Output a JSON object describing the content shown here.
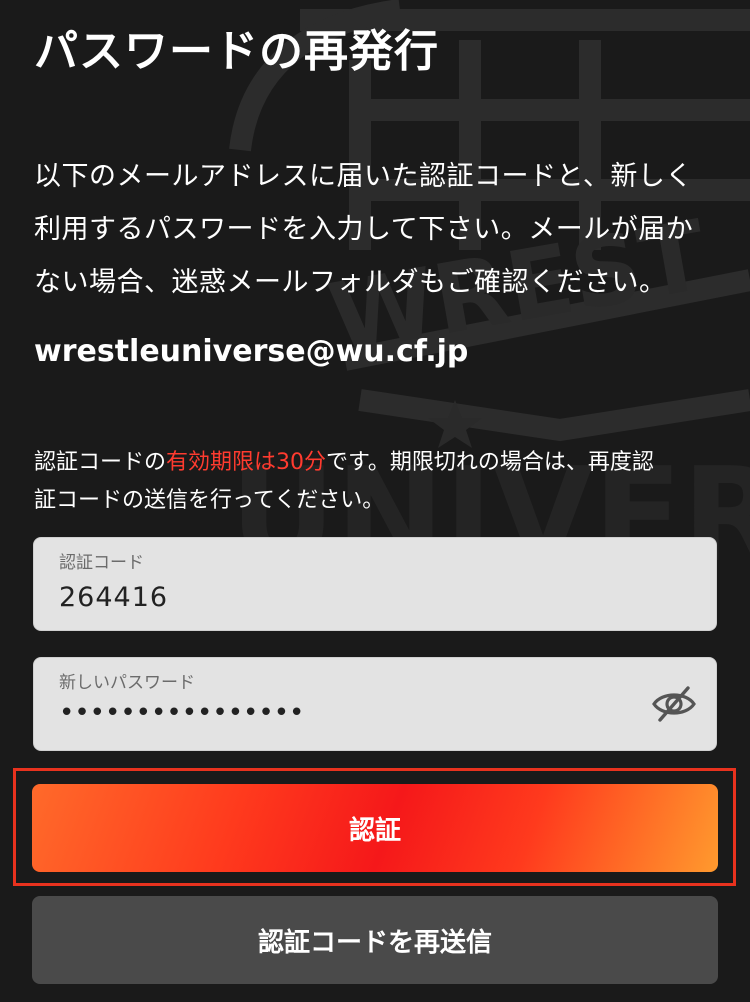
{
  "page": {
    "title": "パスワードの再発行"
  },
  "description": {
    "lines": [
      "以下のメールアドレスに届いた認証コードと、新しく",
      "利用するパスワードを入力して下さい。メールが届か",
      "ない場合、迷惑メールフォルダもご確認ください。"
    ]
  },
  "email": "wrestleuniverse@wu.cf.jp",
  "expiry_note": {
    "prefix": "認証コードの",
    "highlight": "有効期限は30分",
    "suffix": "です。期限切れの場合は、再度認",
    "line2": "証コードの送信を行ってください。"
  },
  "code_field": {
    "label": "認証コード",
    "value": "264416"
  },
  "password_field": {
    "label": "新しいパスワード",
    "value": "••••••••••••••••",
    "toggle_icon": "eye-slash-icon"
  },
  "buttons": {
    "verify_label": "認証",
    "resend_label": "認証コードを再送信"
  },
  "colors": {
    "background": "#1a1a1a",
    "accent_red": "#ff3b2f",
    "field_bg": "#e3e3e3",
    "secondary_button": "#4a4a4a"
  }
}
